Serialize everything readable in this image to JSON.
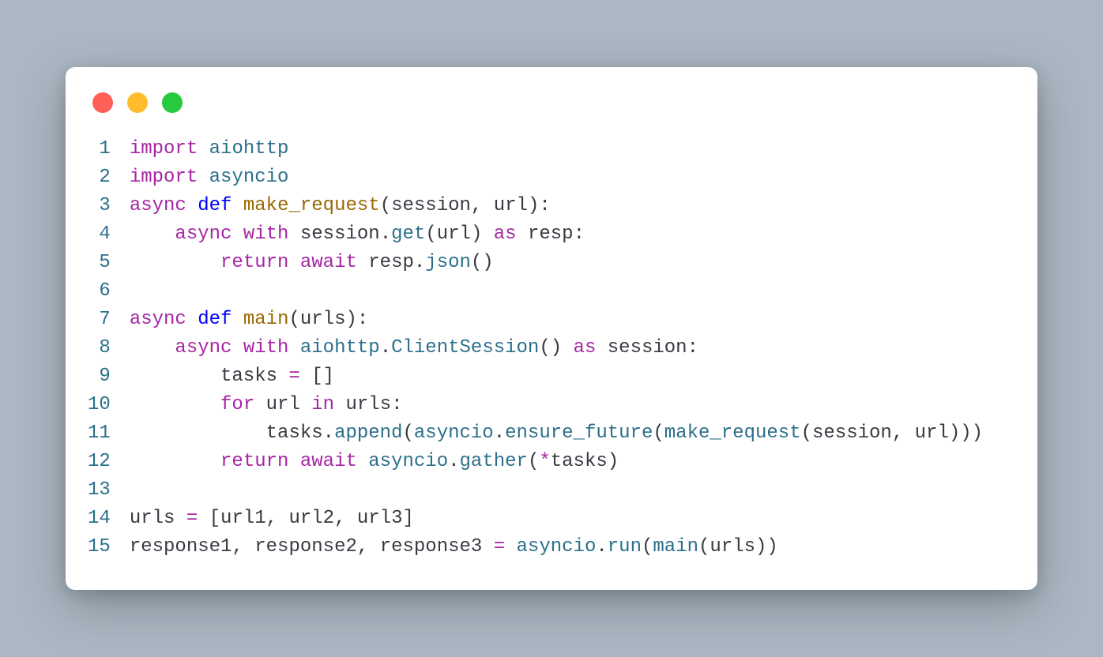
{
  "window": {
    "traffic_lights": {
      "red": "#ff5f56",
      "yellow": "#ffbd2e",
      "green": "#27c93f"
    }
  },
  "code": {
    "language": "python",
    "lines": [
      {
        "n": "1",
        "tokens": [
          {
            "t": "import",
            "c": "kw"
          },
          {
            "t": " ",
            "c": "txt"
          },
          {
            "t": "aiohttp",
            "c": "mod"
          }
        ]
      },
      {
        "n": "2",
        "tokens": [
          {
            "t": "import",
            "c": "kw"
          },
          {
            "t": " ",
            "c": "txt"
          },
          {
            "t": "asyncio",
            "c": "mod"
          }
        ]
      },
      {
        "n": "3",
        "tokens": [
          {
            "t": "async",
            "c": "kw"
          },
          {
            "t": " ",
            "c": "txt"
          },
          {
            "t": "def",
            "c": "def"
          },
          {
            "t": " ",
            "c": "txt"
          },
          {
            "t": "make_request",
            "c": "fn"
          },
          {
            "t": "(",
            "c": "par"
          },
          {
            "t": "session",
            "c": "txt"
          },
          {
            "t": ",",
            "c": "punc"
          },
          {
            "t": " ",
            "c": "txt"
          },
          {
            "t": "url",
            "c": "txt"
          },
          {
            "t": "):",
            "c": "par"
          }
        ]
      },
      {
        "n": "4",
        "tokens": [
          {
            "t": "    ",
            "c": "txt"
          },
          {
            "t": "async",
            "c": "kw"
          },
          {
            "t": " ",
            "c": "txt"
          },
          {
            "t": "with",
            "c": "kw"
          },
          {
            "t": " ",
            "c": "txt"
          },
          {
            "t": "session",
            "c": "txt"
          },
          {
            "t": ".",
            "c": "punc"
          },
          {
            "t": "get",
            "c": "call"
          },
          {
            "t": "(",
            "c": "par"
          },
          {
            "t": "url",
            "c": "txt"
          },
          {
            "t": ")",
            "c": "par"
          },
          {
            "t": " ",
            "c": "txt"
          },
          {
            "t": "as",
            "c": "kw"
          },
          {
            "t": " ",
            "c": "txt"
          },
          {
            "t": "resp",
            "c": "txt"
          },
          {
            "t": ":",
            "c": "punc"
          }
        ]
      },
      {
        "n": "5",
        "tokens": [
          {
            "t": "        ",
            "c": "txt"
          },
          {
            "t": "return",
            "c": "kw"
          },
          {
            "t": " ",
            "c": "txt"
          },
          {
            "t": "await",
            "c": "kw"
          },
          {
            "t": " ",
            "c": "txt"
          },
          {
            "t": "resp",
            "c": "txt"
          },
          {
            "t": ".",
            "c": "punc"
          },
          {
            "t": "json",
            "c": "call"
          },
          {
            "t": "()",
            "c": "par"
          }
        ]
      },
      {
        "n": "6",
        "tokens": [
          {
            "t": "",
            "c": "txt"
          }
        ]
      },
      {
        "n": "7",
        "tokens": [
          {
            "t": "async",
            "c": "kw"
          },
          {
            "t": " ",
            "c": "txt"
          },
          {
            "t": "def",
            "c": "def"
          },
          {
            "t": " ",
            "c": "txt"
          },
          {
            "t": "main",
            "c": "fn"
          },
          {
            "t": "(",
            "c": "par"
          },
          {
            "t": "urls",
            "c": "txt"
          },
          {
            "t": "):",
            "c": "par"
          }
        ]
      },
      {
        "n": "8",
        "tokens": [
          {
            "t": "    ",
            "c": "txt"
          },
          {
            "t": "async",
            "c": "kw"
          },
          {
            "t": " ",
            "c": "txt"
          },
          {
            "t": "with",
            "c": "kw"
          },
          {
            "t": " ",
            "c": "txt"
          },
          {
            "t": "aiohttp",
            "c": "mod"
          },
          {
            "t": ".",
            "c": "punc"
          },
          {
            "t": "ClientSession",
            "c": "call"
          },
          {
            "t": "()",
            "c": "par"
          },
          {
            "t": " ",
            "c": "txt"
          },
          {
            "t": "as",
            "c": "kw"
          },
          {
            "t": " ",
            "c": "txt"
          },
          {
            "t": "session",
            "c": "txt"
          },
          {
            "t": ":",
            "c": "punc"
          }
        ]
      },
      {
        "n": "9",
        "tokens": [
          {
            "t": "        ",
            "c": "txt"
          },
          {
            "t": "tasks",
            "c": "txt"
          },
          {
            "t": " ",
            "c": "txt"
          },
          {
            "t": "=",
            "c": "op"
          },
          {
            "t": " ",
            "c": "txt"
          },
          {
            "t": "[]",
            "c": "par"
          }
        ]
      },
      {
        "n": "10",
        "tokens": [
          {
            "t": "        ",
            "c": "txt"
          },
          {
            "t": "for",
            "c": "kw"
          },
          {
            "t": " ",
            "c": "txt"
          },
          {
            "t": "url",
            "c": "txt"
          },
          {
            "t": " ",
            "c": "txt"
          },
          {
            "t": "in",
            "c": "kw"
          },
          {
            "t": " ",
            "c": "txt"
          },
          {
            "t": "urls",
            "c": "txt"
          },
          {
            "t": ":",
            "c": "punc"
          }
        ]
      },
      {
        "n": "11",
        "tokens": [
          {
            "t": "            ",
            "c": "txt"
          },
          {
            "t": "tasks",
            "c": "txt"
          },
          {
            "t": ".",
            "c": "punc"
          },
          {
            "t": "append",
            "c": "call"
          },
          {
            "t": "(",
            "c": "par"
          },
          {
            "t": "asyncio",
            "c": "mod"
          },
          {
            "t": ".",
            "c": "punc"
          },
          {
            "t": "ensure_future",
            "c": "call"
          },
          {
            "t": "(",
            "c": "par"
          },
          {
            "t": "make_request",
            "c": "call"
          },
          {
            "t": "(",
            "c": "par"
          },
          {
            "t": "session",
            "c": "txt"
          },
          {
            "t": ",",
            "c": "punc"
          },
          {
            "t": " ",
            "c": "txt"
          },
          {
            "t": "url",
            "c": "txt"
          },
          {
            "t": ")))",
            "c": "par"
          }
        ]
      },
      {
        "n": "12",
        "tokens": [
          {
            "t": "        ",
            "c": "txt"
          },
          {
            "t": "return",
            "c": "kw"
          },
          {
            "t": " ",
            "c": "txt"
          },
          {
            "t": "await",
            "c": "kw"
          },
          {
            "t": " ",
            "c": "txt"
          },
          {
            "t": "asyncio",
            "c": "mod"
          },
          {
            "t": ".",
            "c": "punc"
          },
          {
            "t": "gather",
            "c": "call"
          },
          {
            "t": "(",
            "c": "par"
          },
          {
            "t": "*",
            "c": "op"
          },
          {
            "t": "tasks",
            "c": "txt"
          },
          {
            "t": ")",
            "c": "par"
          }
        ]
      },
      {
        "n": "13",
        "tokens": [
          {
            "t": "",
            "c": "txt"
          }
        ]
      },
      {
        "n": "14",
        "tokens": [
          {
            "t": "urls",
            "c": "txt"
          },
          {
            "t": " ",
            "c": "txt"
          },
          {
            "t": "=",
            "c": "op"
          },
          {
            "t": " ",
            "c": "txt"
          },
          {
            "t": "[",
            "c": "par"
          },
          {
            "t": "url1",
            "c": "txt"
          },
          {
            "t": ",",
            "c": "punc"
          },
          {
            "t": " ",
            "c": "txt"
          },
          {
            "t": "url2",
            "c": "txt"
          },
          {
            "t": ",",
            "c": "punc"
          },
          {
            "t": " ",
            "c": "txt"
          },
          {
            "t": "url3",
            "c": "txt"
          },
          {
            "t": "]",
            "c": "par"
          }
        ]
      },
      {
        "n": "15",
        "tokens": [
          {
            "t": "response1",
            "c": "txt"
          },
          {
            "t": ",",
            "c": "punc"
          },
          {
            "t": " ",
            "c": "txt"
          },
          {
            "t": "response2",
            "c": "txt"
          },
          {
            "t": ",",
            "c": "punc"
          },
          {
            "t": " ",
            "c": "txt"
          },
          {
            "t": "response3",
            "c": "txt"
          },
          {
            "t": " ",
            "c": "txt"
          },
          {
            "t": "=",
            "c": "op"
          },
          {
            "t": " ",
            "c": "txt"
          },
          {
            "t": "asyncio",
            "c": "mod"
          },
          {
            "t": ".",
            "c": "punc"
          },
          {
            "t": "run",
            "c": "call"
          },
          {
            "t": "(",
            "c": "par"
          },
          {
            "t": "main",
            "c": "call"
          },
          {
            "t": "(",
            "c": "par"
          },
          {
            "t": "urls",
            "c": "txt"
          },
          {
            "t": "))",
            "c": "par"
          }
        ]
      }
    ]
  }
}
